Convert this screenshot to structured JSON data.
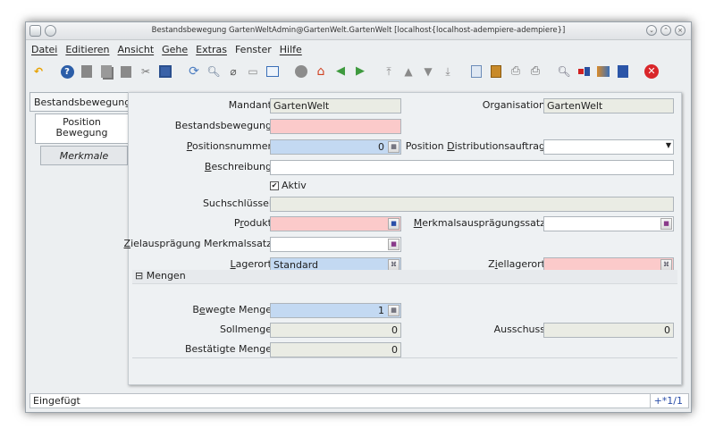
{
  "window": {
    "title": "Bestandsbewegung  GartenWeltAdmin@GartenWelt.GartenWelt [localhost{localhost-adempiere-adempiere}]"
  },
  "menu": {
    "items": [
      "Datei",
      "Editieren",
      "Ansicht",
      "Gehe",
      "Extras",
      "Fenster",
      "Hilfe"
    ]
  },
  "toolbar": {
    "icons": [
      "undo-icon",
      "help-icon",
      "new-icon",
      "copy-icon",
      "delete-icon",
      "delete-selection-icon",
      "save-icon",
      "refresh-icon",
      "find-icon",
      "attachment-icon",
      "chat-icon",
      "grid-toggle-icon",
      "history-icon",
      "home-icon",
      "back-icon",
      "forward-icon",
      "first-record-icon",
      "previous-record-icon",
      "next-record-icon",
      "last-record-icon",
      "report-icon",
      "archive-icon",
      "print-preview-icon",
      "print-icon",
      "zoom-across-icon",
      "active-workflows-icon",
      "product-info-icon",
      "request-icon",
      "close-window-icon"
    ]
  },
  "tabs": [
    {
      "label": "Bestandsbewegung"
    },
    {
      "label_line1": "Position",
      "label_line2": "Bewegung"
    },
    {
      "label": "Merkmale"
    }
  ],
  "form": {
    "mandant_label": "Mandant",
    "mandant_value": "GartenWelt",
    "organisation_label": "Organisation",
    "organisation_value": "GartenWelt",
    "bestandsbewegung_label": "Bestandsbewegung",
    "bestandsbewegung_value": "",
    "positionsnummer_label_u": "P",
    "positionsnummer_label_rest": "ositionsnummer",
    "positionsnummer_value": "0",
    "distributionsauftrag_label_pre": "Position ",
    "distributionsauftrag_label_u": "D",
    "distributionsauftrag_label_rest": "istributionsauftrag",
    "distributionsauftrag_value": "",
    "beschreibung_label_u": "B",
    "beschreibung_label_rest": "eschreibung",
    "beschreibung_value": "",
    "aktiv_label": "Aktiv",
    "aktiv_checked": true,
    "suchschluessel_label": "Suchschlüssel",
    "suchschluessel_value": "",
    "produkt_label_pre": "P",
    "produkt_label_u": "r",
    "produkt_label_rest": "odukt",
    "produkt_value": "",
    "merkmalsausp_label_u": "M",
    "merkmalsausp_label_rest": "erkmalsausprägungssatz",
    "merkmalsausp_value": "",
    "zielausp_label_u": "Z",
    "zielausp_label_rest": "ielausprägung Merkmalssatz",
    "zielausp_value": "",
    "lagerort_label_u": "L",
    "lagerort_label_rest": "agerort",
    "lagerort_value": "Standard",
    "ziellagerort_label_pre": "Z",
    "ziellagerort_label_u": "i",
    "ziellagerort_label_rest": "ellagerort",
    "ziellagerort_value": ""
  },
  "mengen": {
    "section_label": "Mengen",
    "bewegte_label_pre": "B",
    "bewegte_label_u": "e",
    "bewegte_label_rest": "wegte Menge",
    "bewegte_value": "1",
    "sollmenge_label": "Sollmenge",
    "sollmenge_value": "0",
    "ausschuss_label": "Ausschuss",
    "ausschuss_value": "0",
    "bestaetigte_label": "Bestätigte Menge",
    "bestaetigte_value": "0"
  },
  "status": {
    "message": "Eingefügt",
    "record_info": "+*1/1"
  },
  "colors": {
    "mandatory": "#fbcaca",
    "numeric": "#c3d9f2",
    "readonly": "#eaece4",
    "close_red": "#d9262a"
  }
}
